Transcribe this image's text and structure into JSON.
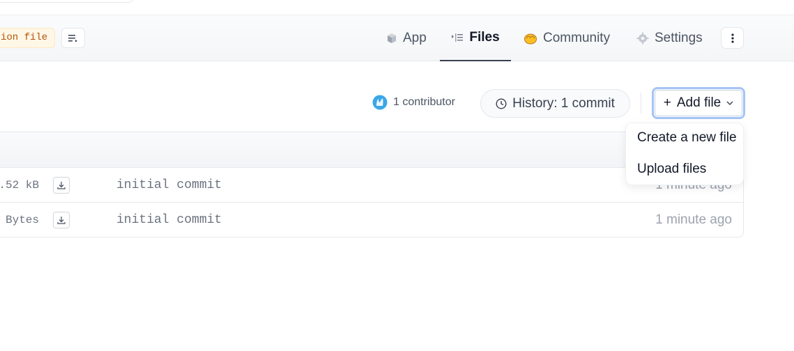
{
  "header": {
    "tag_text": "ion file",
    "tabs": {
      "app": "App",
      "files": "Files",
      "community": "Community",
      "settings": "Settings"
    }
  },
  "actions": {
    "contributors": "1 contributor",
    "history": "History: 1 commit",
    "add_file": "Add file",
    "add_file_prefix": "+"
  },
  "dropdown": {
    "items": [
      "Create a new file",
      "Upload files"
    ]
  },
  "files": [
    {
      "size": ".52 kB",
      "message": "initial commit",
      "time": "1 minute ago"
    },
    {
      "size": "Bytes",
      "message": "initial commit",
      "time": "1 minute ago"
    }
  ],
  "colors": {
    "tag_bg": "#fff7e6",
    "tag_text": "#b45309",
    "add_focus_ring": "#a5c4f5",
    "community_emoji": "#fbbf24",
    "contributor_avatar": "#3ba7e8"
  },
  "icons": {
    "app": "cube-icon",
    "files": "files-list-icon",
    "community": "hands-icon",
    "settings": "gear-icon",
    "more": "vertical-dots-icon",
    "history": "clock-icon",
    "download": "download-icon",
    "add_chevron": "chevron-down-icon"
  }
}
